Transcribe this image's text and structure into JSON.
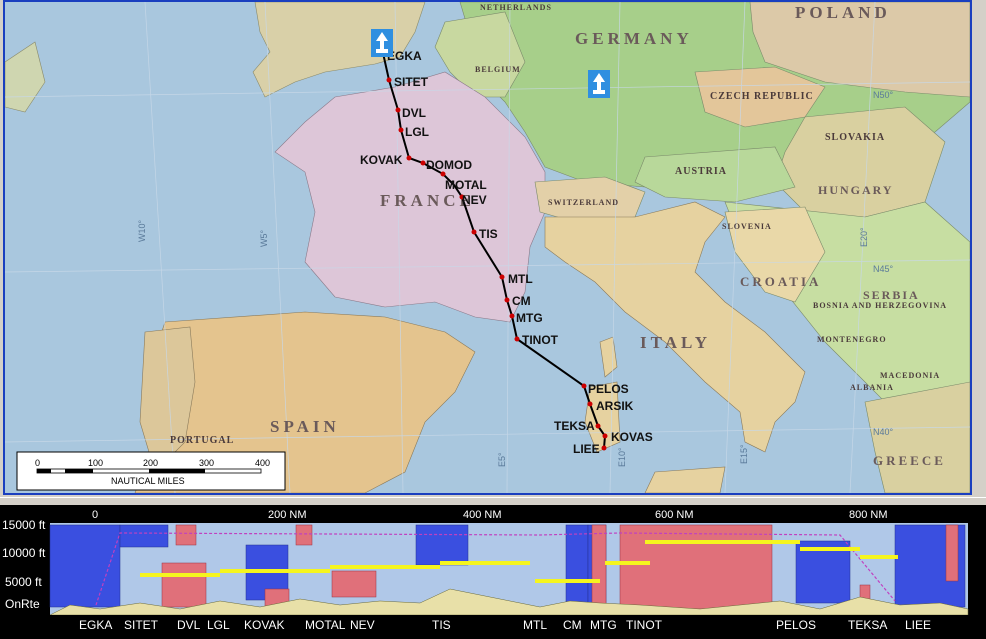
{
  "map": {
    "countries": {
      "germany": "GERMANY",
      "poland": "POLAND",
      "france": "FRANCE",
      "spain": "SPAIN",
      "italy": "ITALY",
      "portugal": "PORTUGAL",
      "netherlands": "NETHERLANDS",
      "belgium": "BELGIUM",
      "czech": "CZECH REPUBLIC",
      "slovakia": "SLOVAKIA",
      "austria": "AUSTRIA",
      "hungary": "HUNGARY",
      "switzerland": "SWITZERLAND",
      "slovenia": "SLOVENIA",
      "croatia": "CROATIA",
      "serbia": "SERBIA",
      "bosnia": "BOSNIA AND HERZEGOVINA",
      "montenegro": "MONTENEGRO",
      "albania": "ALBANIA",
      "macedonia": "MACEDONIA",
      "greece": "GREECE"
    },
    "grid_labels": [
      "N50°",
      "N45°",
      "N40°",
      "W10°",
      "W5°",
      "E5°",
      "E10°",
      "E15°",
      "E20°"
    ],
    "waypoints": [
      "EGKA",
      "SITET",
      "DVL",
      "LGL",
      "KOVAK",
      "DOMOD",
      "MOTAL",
      "NEV",
      "TIS",
      "MTL",
      "CM",
      "MTG",
      "TINOT",
      "PELOS",
      "ARSIK",
      "TEKSA",
      "KOVAS",
      "LIEE"
    ],
    "scale_bar": {
      "ticks": [
        "0",
        "100",
        "200",
        "300",
        "400"
      ],
      "caption": "NAUTICAL MILES"
    },
    "airport_icons": [
      "departure-airport-icon",
      "airport-icon-germany"
    ],
    "colors": {
      "route": "#000000",
      "waypoint": "#cc0000",
      "sea": "#a9c7de",
      "frame": "#1a3fbf"
    }
  },
  "profile": {
    "y_labels": [
      "15000 ft",
      "10000 ft",
      "5000 ft",
      "OnRte"
    ],
    "x_labels": [
      "0",
      "200 NM",
      "400 NM",
      "600 NM",
      "800 NM"
    ],
    "waypoint_labels": [
      "EGKA",
      "SITET",
      "DVL",
      "LGL",
      "KOVAK",
      "MOTAL",
      "NEV",
      "TIS",
      "MTL",
      "CM",
      "MTG",
      "TINOT",
      "PELOS",
      "TEKSA",
      "LIEE"
    ],
    "colors": {
      "background": "#b0c8e8",
      "weather": "#3a4fe0",
      "restricted": "#e0707a",
      "route_altitude": "#f5f51e",
      "terrain": "#e8e0a8"
    }
  }
}
